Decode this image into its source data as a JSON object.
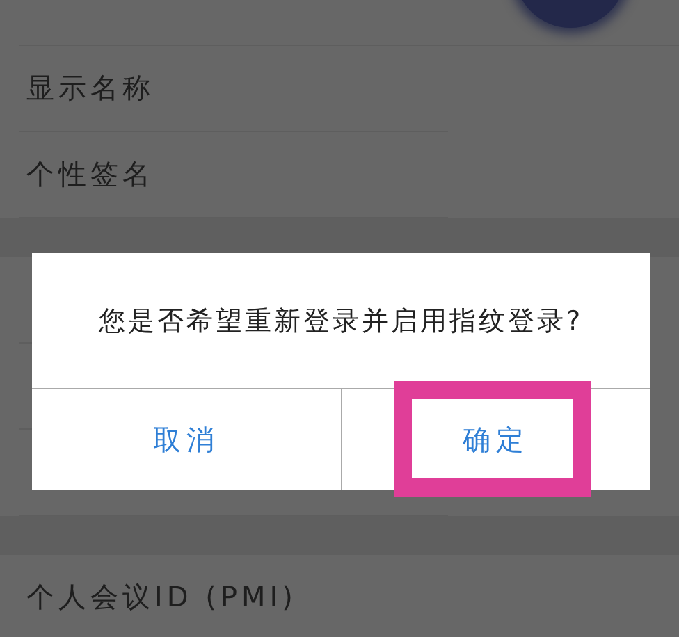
{
  "settings": {
    "items": [
      {
        "kind": "avatar"
      },
      {
        "kind": "row",
        "label": "显示名称"
      },
      {
        "kind": "row",
        "label": "个性签名"
      },
      {
        "kind": "gap"
      },
      {
        "kind": "row"
      },
      {
        "kind": "row"
      },
      {
        "kind": "row"
      },
      {
        "kind": "gap"
      },
      {
        "kind": "row",
        "label": "个人会议ID (PMI)"
      }
    ]
  },
  "dialog": {
    "message": "您是否希望重新登录并启用指纹登录?",
    "buttons": [
      {
        "label": "取消",
        "highlighted": false
      },
      {
        "label": "确定",
        "highlighted": true
      }
    ]
  }
}
